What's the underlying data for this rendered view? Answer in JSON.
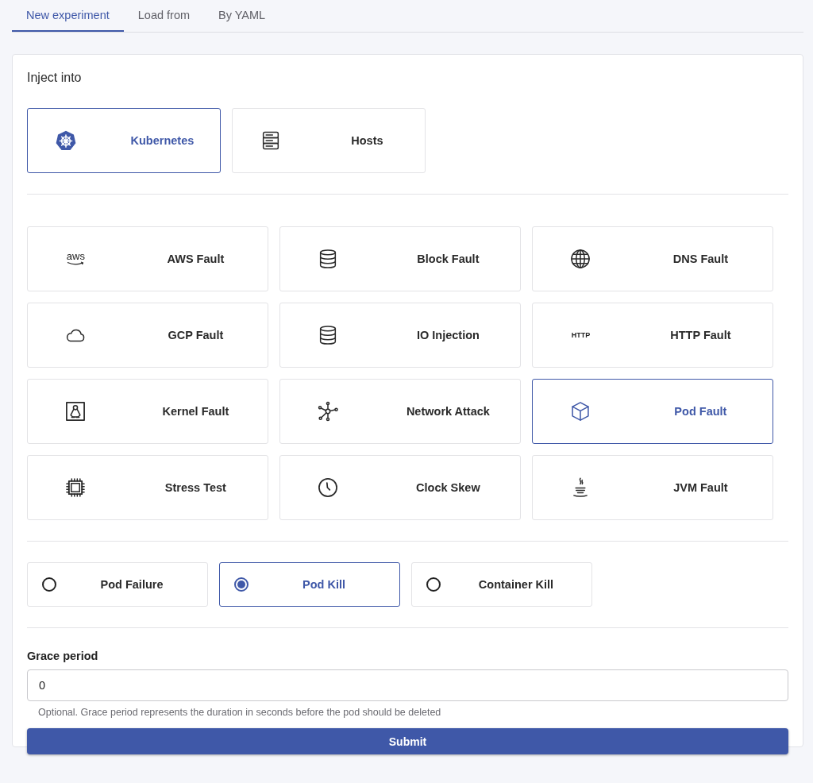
{
  "tabs": [
    {
      "label": "New experiment",
      "selected": true
    },
    {
      "label": "Load from",
      "selected": false
    },
    {
      "label": "By YAML",
      "selected": false
    }
  ],
  "inject_into": {
    "title": "Inject into",
    "targets": [
      {
        "label": "Kubernetes",
        "kind": "kubernetes",
        "selected": true
      },
      {
        "label": "Hosts",
        "kind": "server",
        "selected": false
      }
    ]
  },
  "faults": [
    {
      "label": "AWS Fault",
      "kind": "aws",
      "icon_text": "aws",
      "selected": false
    },
    {
      "label": "Block Fault",
      "kind": "database",
      "selected": false
    },
    {
      "label": "DNS Fault",
      "kind": "globe",
      "selected": false
    },
    {
      "label": "GCP Fault",
      "kind": "cloud",
      "selected": false
    },
    {
      "label": "IO Injection",
      "kind": "database",
      "selected": false
    },
    {
      "label": "HTTP Fault",
      "kind": "http",
      "icon_text": "HTTP",
      "selected": false
    },
    {
      "label": "Kernel Fault",
      "kind": "linux",
      "selected": false
    },
    {
      "label": "Network Attack",
      "kind": "network",
      "selected": false
    },
    {
      "label": "Pod Fault",
      "kind": "cube",
      "selected": true
    },
    {
      "label": "Stress Test",
      "kind": "chip",
      "selected": false
    },
    {
      "label": "Clock Skew",
      "kind": "clock",
      "selected": false
    },
    {
      "label": "JVM Fault",
      "kind": "java",
      "selected": false
    }
  ],
  "actions": [
    {
      "label": "Pod Failure",
      "selected": false
    },
    {
      "label": "Pod Kill",
      "selected": true
    },
    {
      "label": "Container Kill",
      "selected": false
    }
  ],
  "grace_period": {
    "label": "Grace period",
    "value": "0",
    "helper": "Optional. Grace period represents the duration in seconds before the pod should be deleted"
  },
  "submit": "Submit"
}
